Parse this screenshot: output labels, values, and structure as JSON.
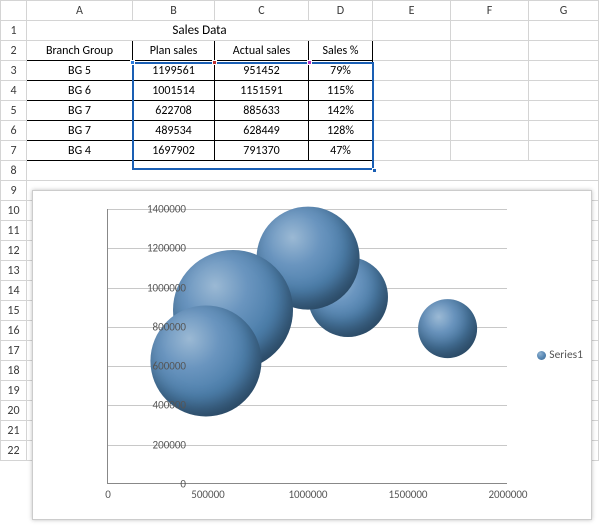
{
  "columns": [
    "A",
    "B",
    "C",
    "D",
    "E",
    "F",
    "G"
  ],
  "rows": [
    "1",
    "2",
    "3",
    "4",
    "5",
    "6",
    "7",
    "8",
    "9",
    "10",
    "11",
    "12",
    "13",
    "14",
    "15",
    "16",
    "17",
    "18",
    "19",
    "20",
    "21",
    "22"
  ],
  "title": "Sales Data",
  "headers": {
    "a": "Branch Group",
    "b": "Plan sales",
    "c": "Actual sales",
    "d": "Sales %"
  },
  "data": [
    {
      "grp": "BG 5",
      "plan": "1199561",
      "actual": "951452",
      "pct": "79%"
    },
    {
      "grp": "BG 6",
      "plan": "1001514",
      "actual": "1151591",
      "pct": "115%"
    },
    {
      "grp": "BG 7",
      "plan": "622708",
      "actual": "885633",
      "pct": "142%"
    },
    {
      "grp": "BG 7",
      "plan": "489534",
      "actual": "628449",
      "pct": "128%"
    },
    {
      "grp": "BG 4",
      "plan": "1697902",
      "actual": "791370",
      "pct": "47%"
    }
  ],
  "legend": "Series1",
  "chart_data": {
    "type": "bubble",
    "xlabel": "",
    "ylabel": "",
    "xlim": [
      0,
      2000000
    ],
    "ylim": [
      0,
      1400000
    ],
    "xticks": [
      0,
      500000,
      1000000,
      1500000,
      2000000
    ],
    "yticks": [
      0,
      200000,
      400000,
      600000,
      800000,
      1000000,
      1200000,
      1400000
    ],
    "series": [
      {
        "name": "Series1",
        "points": [
          {
            "x": 1199561,
            "y": 951452,
            "size": 0.79
          },
          {
            "x": 1001514,
            "y": 1151591,
            "size": 1.15
          },
          {
            "x": 622708,
            "y": 885633,
            "size": 1.42
          },
          {
            "x": 489534,
            "y": 628449,
            "size": 1.28
          },
          {
            "x": 1697902,
            "y": 791370,
            "size": 0.47
          }
        ]
      }
    ]
  },
  "y_axis_labels": [
    "0",
    "200000",
    "400000",
    "600000",
    "800000",
    "1000000",
    "1200000",
    "1400000"
  ],
  "x_axis_labels": [
    "0",
    "500000",
    "1000000",
    "1500000",
    "2000000"
  ]
}
